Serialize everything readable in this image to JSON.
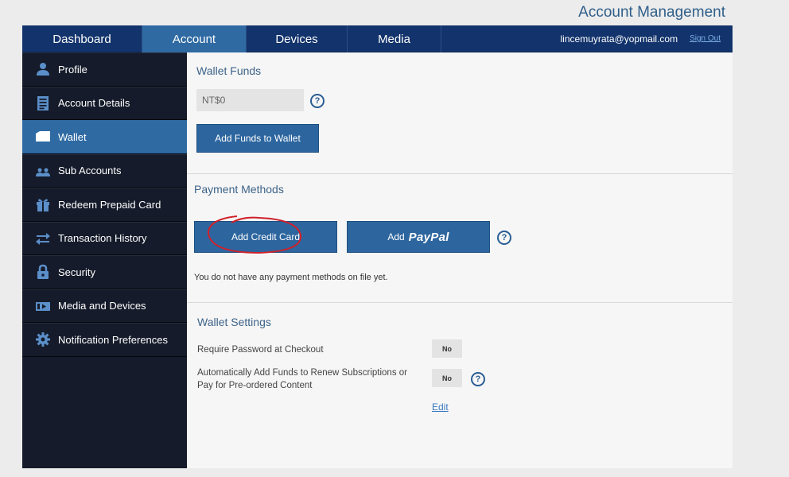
{
  "header": {
    "title": "Account Management"
  },
  "nav": {
    "tabs": [
      {
        "label": "Dashboard",
        "active": false
      },
      {
        "label": "Account",
        "active": true
      },
      {
        "label": "Devices",
        "active": false
      },
      {
        "label": "Media",
        "active": false
      }
    ],
    "user_email": "lincemuyrata@yopmail.com",
    "sign_out": "Sign Out"
  },
  "sidebar": {
    "items": [
      {
        "label": "Profile",
        "icon": "user-icon"
      },
      {
        "label": "Account Details",
        "icon": "document-icon"
      },
      {
        "label": "Wallet",
        "icon": "wallet-icon",
        "active": true
      },
      {
        "label": "Sub Accounts",
        "icon": "users-icon"
      },
      {
        "label": "Redeem Prepaid Card",
        "icon": "gift-icon"
      },
      {
        "label": "Transaction History",
        "icon": "transfer-arrows-icon"
      },
      {
        "label": "Security",
        "icon": "lock-icon"
      },
      {
        "label": "Media and Devices",
        "icon": "media-icon"
      },
      {
        "label": "Notification Preferences",
        "icon": "gear-icon"
      }
    ]
  },
  "wallet_funds": {
    "title": "Wallet Funds",
    "balance": "NT$0",
    "add_funds_button": "Add Funds to Wallet"
  },
  "payment_methods": {
    "title": "Payment Methods",
    "add_credit_card_button": "Add Credit Card",
    "add_paypal_prefix": "Add",
    "paypal_brand": "PayPal",
    "empty_note": "You do not have any payment methods on file yet."
  },
  "wallet_settings": {
    "title": "Wallet Settings",
    "require_password_label": "Require Password at Checkout",
    "require_password_value": "No",
    "auto_add_label_line1": "Automatically Add Funds to Renew Subscriptions or",
    "auto_add_label_line2": "Pay for Pre-ordered Content",
    "auto_add_value": "No",
    "edit_link": "Edit"
  },
  "help_glyph": "?",
  "colors": {
    "nav_bg": "#12336b",
    "active_tab": "#2f6aa3",
    "sidebar_bg": "#151b2a",
    "button_blue": "#2d669f",
    "annotation_red": "#d0202a"
  }
}
